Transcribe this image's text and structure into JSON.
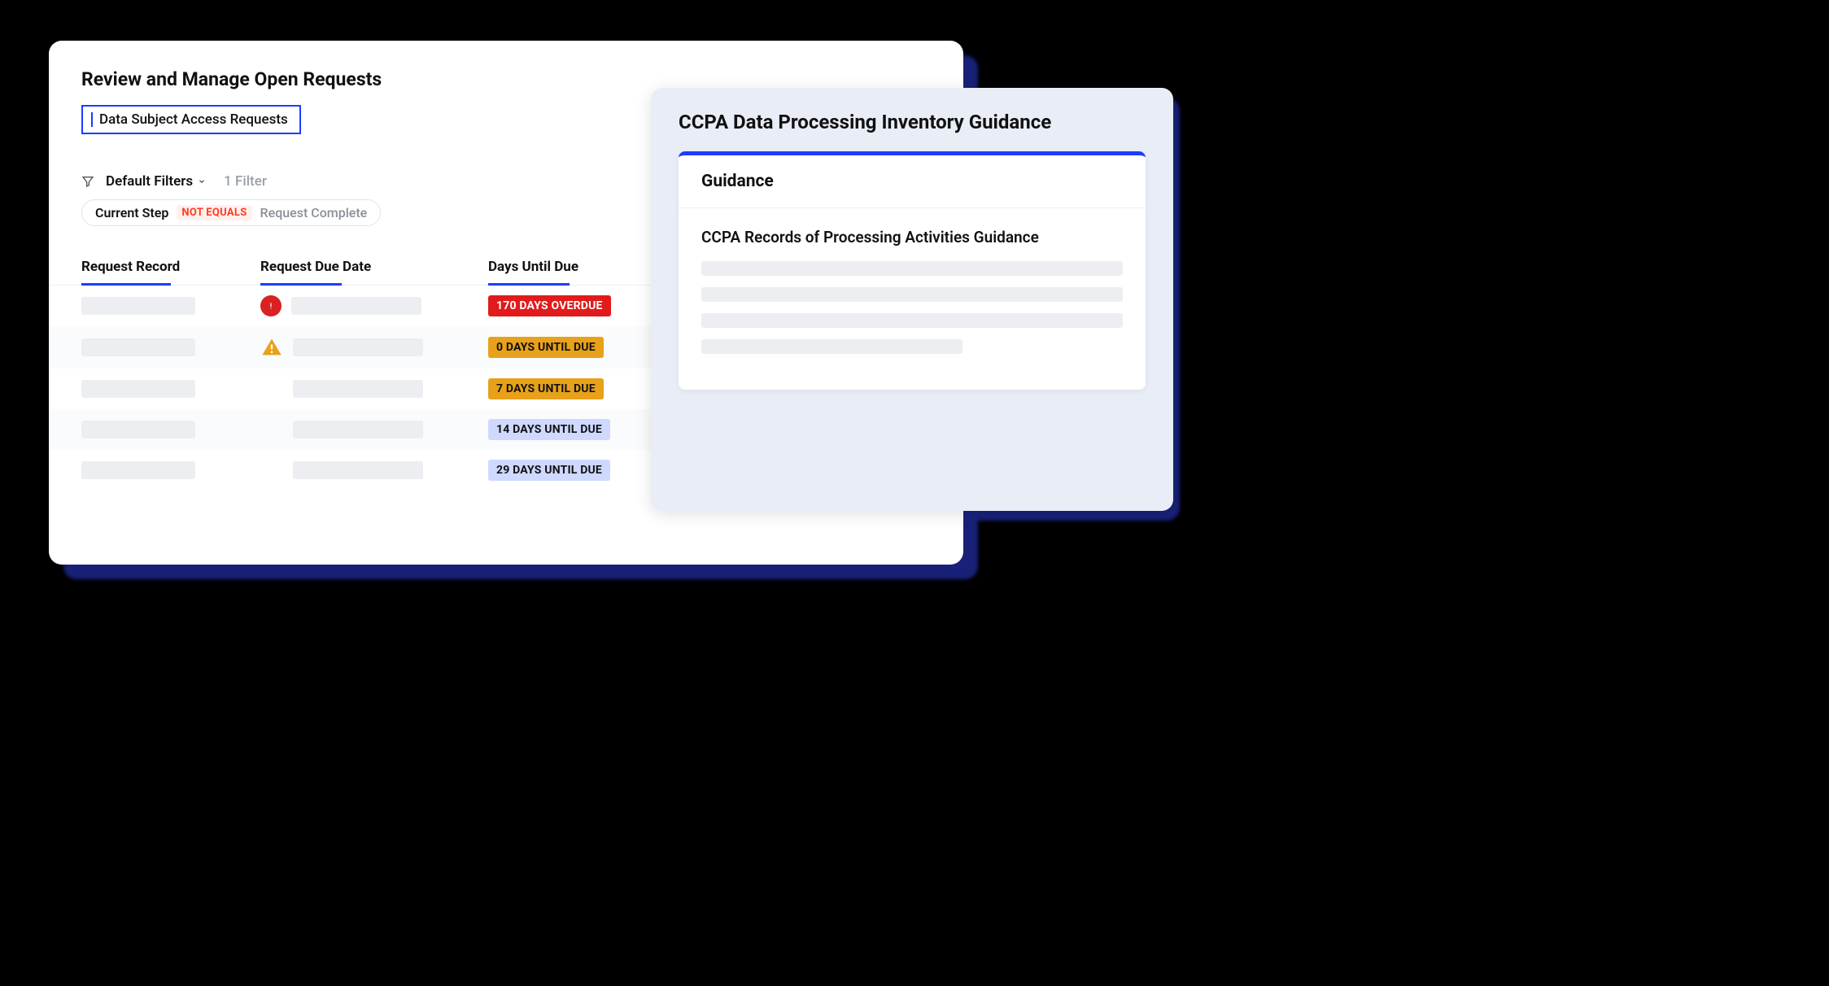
{
  "main": {
    "title": "Review and Manage Open Requests",
    "tab_label": "Data Subject Access Requests",
    "filters": {
      "label": "Default Filters",
      "count_label": "1 Filter"
    },
    "filter_pill": {
      "field": "Current Step",
      "operator": "NOT EQUALS",
      "value": "Request Complete"
    },
    "columns": {
      "record": "Request Record",
      "due": "Request Due Date",
      "days": "Days Until Due"
    },
    "rows": [
      {
        "status": "overdue",
        "badge": "170 DAYS OVERDUE"
      },
      {
        "status": "warn",
        "badge": "0 DAYS UNTIL DUE"
      },
      {
        "status": "warn_plain",
        "badge": "7 DAYS UNTIL DUE"
      },
      {
        "status": "soon",
        "badge": "14 DAYS UNTIL DUE"
      },
      {
        "status": "soon",
        "badge": "29 DAYS UNTIL DUE"
      }
    ]
  },
  "guidance": {
    "outer_title": "CCPA Data Processing Inventory Guidance",
    "inner_head": "Guidance",
    "subtitle": "CCPA Records of Processing Activities Guidance"
  }
}
